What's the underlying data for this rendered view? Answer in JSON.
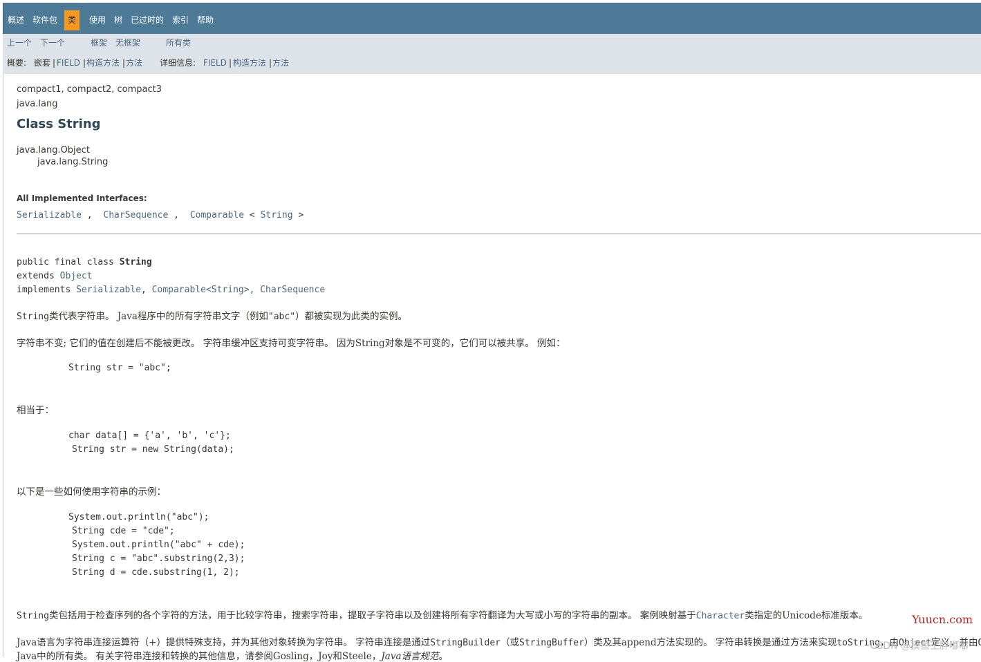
{
  "topnav": {
    "items": [
      "概述",
      "软件包",
      "类",
      "使用",
      "树",
      "已过时的",
      "索引",
      "帮助"
    ],
    "active_index": 2
  },
  "subnav": {
    "prev": "上一个",
    "next": "下一个",
    "frames": "框架",
    "noframes": "无框架",
    "allclasses": "所有类",
    "summary_label": "概要:",
    "summary_nested": "嵌套",
    "summary_field": "FIELD",
    "summary_constr": "构造方法",
    "summary_method": "方法",
    "detail_label": "详细信息:",
    "detail_field": "FIELD",
    "detail_constr": "构造方法",
    "detail_method": "方法",
    "sep": "|"
  },
  "header": {
    "profiles": "compact1, compact2, compact3",
    "package": "java.lang",
    "title": "Class String"
  },
  "inheritance": {
    "parent": "java.lang.Object",
    "child": "java.lang.String"
  },
  "interfaces": {
    "label": "All Implemented Interfaces:",
    "items": [
      "Serializable",
      "CharSequence",
      "Comparable",
      "String"
    ],
    "sep": ",",
    "lt": "<",
    "gt": ">"
  },
  "declaration": {
    "line1_prefix": "public final class ",
    "line1_name": "String",
    "line2_prefix": "extends ",
    "line2_link": "Object",
    "line3_prefix": "implements ",
    "line3_link1": "Serializable",
    "line3_sep1": ", ",
    "line3_link2a": "Comparable",
    "line3_mid": "<",
    "line3_link2b": "String",
    "line3_end": ">, ",
    "line3_link3": "CharSequence"
  },
  "description": {
    "p1_code": "String",
    "p1_text_a": "类代表字符串。 Java程序中的所有字符串文字（例如",
    "p1_code2": "\"abc\"",
    "p1_text_b": "）都被实现为此类的实例。",
    "p2": "字符串不变; 它们的值在创建后不能被更改。 字符串缓冲区支持可变字符串。 因为String对象是不可变的，它们可以被共享。 例如：",
    "code1": "String str = \"abc\";",
    "p3": "相当于：",
    "code2_l1": "char data[] = {'a', 'b', 'c'};",
    "code2_l2": "String str = new String(data);",
    "p4": "以下是一些如何使用字符串的示例：",
    "code3": [
      "System.out.println(\"abc\");",
      "String cde = \"cde\";",
      "System.out.println(\"abc\" + cde);",
      "String c = \"abc\".substring(2,3);",
      "String d = cde.substring(1, 2);"
    ],
    "p5_code": "String",
    "p5_text_a": "类包括用于检查序列的各个字符的方法，用于比较字符串，搜索字符串，提取子字符串以及创建将所有字符翻译为大写或小写的字符串的副本。 案例映射基于",
    "p5_link": "Character",
    "p5_text_b": "类指定的Unicode标准版本。",
    "p6_text_a": "Java语言为字符串连接运算符（+）提供特殊支持，并为其他对象转换为字符串。 字符串连接是通过",
    "p6_code1": "StringBuilder",
    "p6_text_b": "（或",
    "p6_code2": "StringBuffer",
    "p6_text_c": "）类及其append方法实现的。 字符串转换是通过方法",
    "p6_text_d": "来实现",
    "p6_text_e": "toString",
    "p6_text_f": "，由",
    "p6_text_g": "Object",
    "p6_text_h": "定义，并由",
    "p6_text_i": "Ob",
    "p7_text_a": "Java中的所有类。 有关字符串连接和转换的其他信息，请参阅Gosling，Joy和Steele，",
    "p7_italic": "Java语言规范",
    "p7_end": "。"
  },
  "watermark": {
    "site": "Yuucn.com",
    "csdn": "CSDN @摸鱼王胖嘟嘟"
  }
}
